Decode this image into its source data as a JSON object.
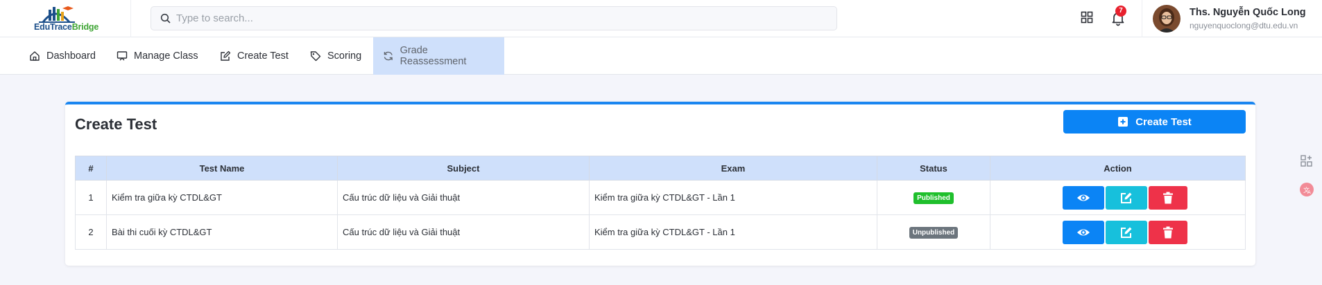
{
  "app": {
    "logo_text_a": "EduTrace",
    "logo_text_b": "Bridge"
  },
  "search": {
    "placeholder": "Type to search..."
  },
  "notifications": {
    "count": "7"
  },
  "user": {
    "name": "Ths. Nguyễn Quốc Long",
    "email": "nguyenquoclong@dtu.edu.vn"
  },
  "nav": {
    "items": [
      {
        "label": "Dashboard",
        "icon": "home-icon"
      },
      {
        "label": "Manage Class",
        "icon": "presentation-icon"
      },
      {
        "label": "Create Test",
        "icon": "edit-icon"
      },
      {
        "label": "Scoring",
        "icon": "tag-icon"
      },
      {
        "label": "Grade Reassessment",
        "icon": "refresh-icon",
        "active": true
      }
    ]
  },
  "card": {
    "title": "Create Test",
    "create_button": "Create Test"
  },
  "table": {
    "columns": [
      "#",
      "Test Name",
      "Subject",
      "Exam",
      "Status",
      "Action"
    ],
    "rows": [
      {
        "num": "1",
        "name": "Kiểm tra giữa kỳ CTDL&GT",
        "subject": "Cấu trúc dữ liệu và Giải thuật",
        "exam": "Kiểm tra giữa kỳ CTDL&GT - Lần 1",
        "status": "Published"
      },
      {
        "num": "2",
        "name": "Bài thi cuối kỳ CTDL&GT",
        "subject": "Cấu trúc dữ liệu và Giải thuật",
        "exam": "Kiểm tra giữa kỳ CTDL&GT - Lần 1",
        "status": "Unpublished"
      }
    ]
  },
  "colors": {
    "primary": "#0b84f5",
    "info": "#17c0dc",
    "danger": "#ee3249",
    "success": "#1fbf2c",
    "secondary": "#6c757d",
    "table_header": "#cfe0fb"
  }
}
